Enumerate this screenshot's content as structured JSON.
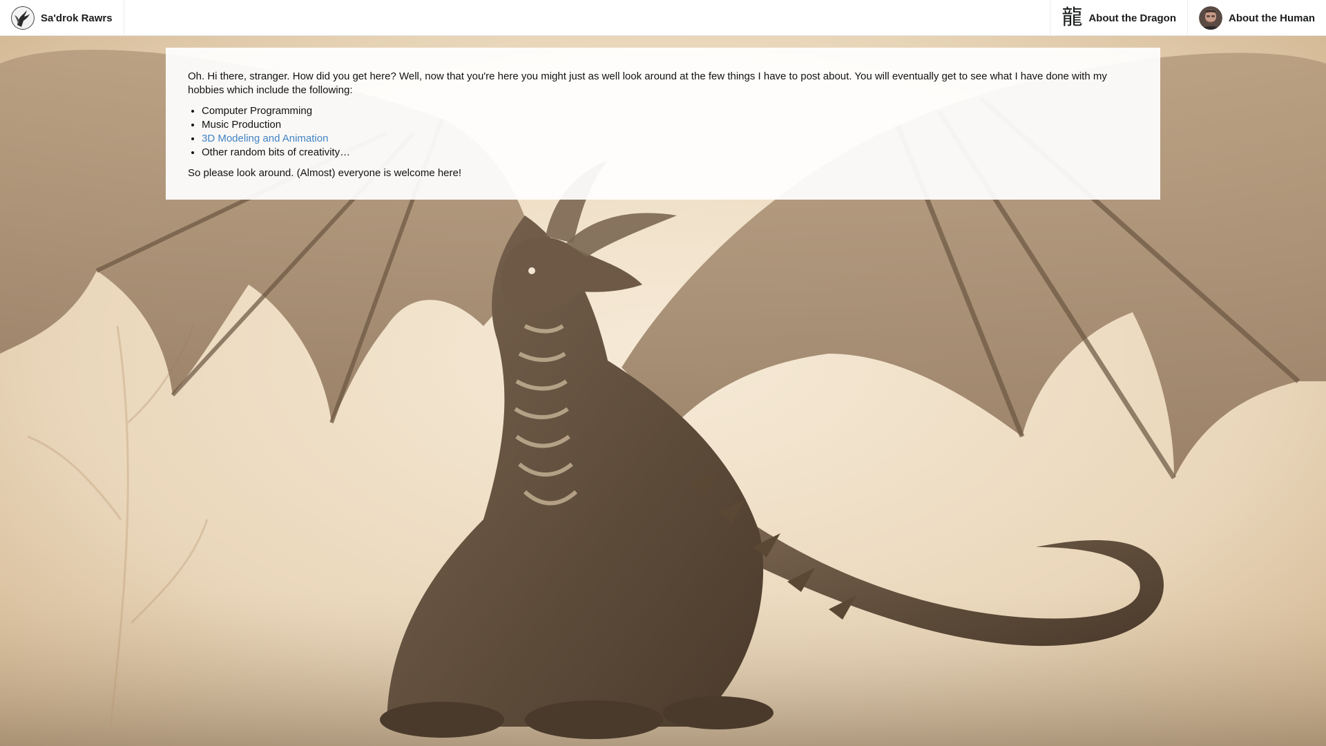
{
  "navbar": {
    "brand_label": "Sa'drok Rawrs",
    "brand_icon": "dragon-sketch-avatar",
    "dragon_glyph": "龍",
    "about_dragon_label": "About the Dragon",
    "about_human_label": "About the Human",
    "human_icon": "human-photo-avatar"
  },
  "main": {
    "intro": "Oh. Hi there, stranger. How did you get here? Well, now that you're here you might just as well look around at the few things I have to post about. You will eventually get to see what I have done with my hobbies which include the following:",
    "hobbies": [
      "Computer Programming",
      "Music Production",
      "3D Modeling and Animation",
      "Other random bits of creativity…"
    ],
    "outro": "So please look around. (Almost) everyone is welcome here!"
  },
  "colors": {
    "link": "#4183c4",
    "background_sepia": "#eddcc3",
    "dragon_brown": "#6e5a44"
  },
  "background": {
    "subject": "sepia illustration of a winged dragon"
  }
}
